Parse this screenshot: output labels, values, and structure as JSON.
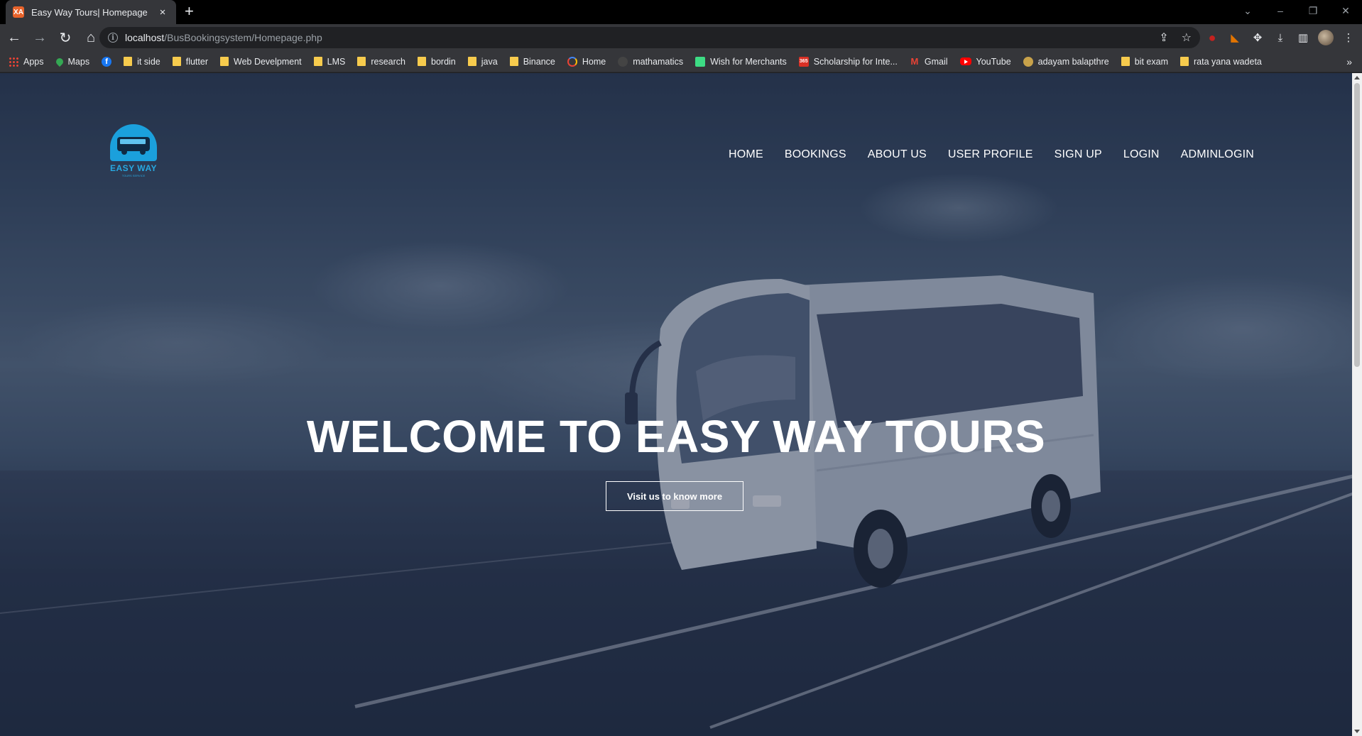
{
  "browser": {
    "tab_title": "Easy Way Tours| Homepage",
    "tab_favicon": "XA",
    "url_host": "localhost",
    "url_path": "/BusBookingsystem/Homepage.php",
    "bookmarks": [
      {
        "label": "Apps",
        "icon": "apps-grid-icon"
      },
      {
        "label": "Maps",
        "icon": "maps-icon"
      },
      {
        "label": "",
        "icon": "facebook-icon"
      },
      {
        "label": "it side",
        "icon": "folder-icon"
      },
      {
        "label": "flutter",
        "icon": "folder-icon"
      },
      {
        "label": "Web Develpment",
        "icon": "folder-icon"
      },
      {
        "label": "LMS",
        "icon": "folder-icon"
      },
      {
        "label": "research",
        "icon": "folder-icon"
      },
      {
        "label": "bordin",
        "icon": "folder-icon"
      },
      {
        "label": "java",
        "icon": "folder-icon"
      },
      {
        "label": "Binance",
        "icon": "folder-icon"
      },
      {
        "label": "Home",
        "icon": "ring-icon"
      },
      {
        "label": "mathamatics",
        "icon": "github-icon"
      },
      {
        "label": "Wish for Merchants",
        "icon": "wish-icon"
      },
      {
        "label": "Scholarship for Inte...",
        "icon": "365-icon"
      },
      {
        "label": "Gmail",
        "icon": "gmail-icon"
      },
      {
        "label": "YouTube",
        "icon": "youtube-icon"
      },
      {
        "label": "adayam balapthre",
        "icon": "bowl-icon"
      },
      {
        "label": "bit exam",
        "icon": "folder-icon"
      },
      {
        "label": "rata yana wadeta",
        "icon": "folder-icon"
      }
    ],
    "more_bookmarks": "»"
  },
  "site": {
    "logo_text": "EASY WAY",
    "logo_subtext": "TOURS SERVICE",
    "nav": [
      "HOME",
      "BOOKINGS",
      "ABOUT US",
      "USER PROFILE",
      "SIGN UP",
      "LOGIN",
      "ADMINLOGIN"
    ],
    "hero_title": "WELCOME TO EASY WAY TOURS",
    "hero_button": "Visit us to know more"
  },
  "colors": {
    "accent": "#1ba0dc",
    "chrome_bg": "#35363a"
  }
}
